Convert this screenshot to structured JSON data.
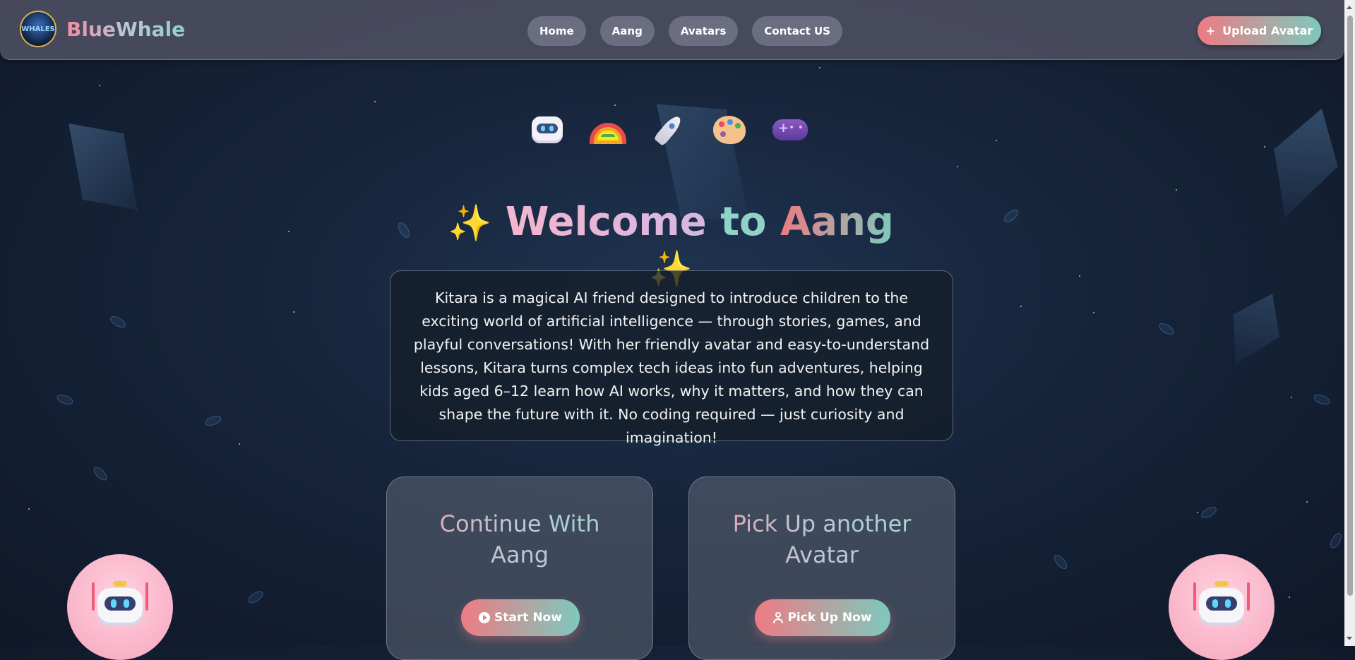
{
  "header": {
    "logo_text": "WHALES",
    "brand": "BlueWhale",
    "nav": [
      {
        "label": "Home"
      },
      {
        "label": "Aang"
      },
      {
        "label": "Avatars"
      },
      {
        "label": "Contact US"
      }
    ],
    "upload_button": {
      "icon": "+",
      "label": "Upload Avatar"
    }
  },
  "hero": {
    "emojis": [
      "robot-icon",
      "rainbow-icon",
      "rocket-icon",
      "palette-icon",
      "gamepad-icon"
    ],
    "title_prefix": "Welcome",
    "title_to": "to",
    "title_name": "Aang",
    "sparkle": "✨",
    "intro": "Kitara is a magical AI friend designed to introduce children to the exciting world of artificial intelligence — through stories, games, and playful conversations! With her friendly avatar and easy-to-understand lessons, Kitara turns complex tech ideas into fun adventures, helping kids aged 6–12 learn how AI works, why it matters, and how they can shape the future with it. No coding required — just curiosity and imagination!"
  },
  "cards": [
    {
      "title": "Continue With Aang",
      "button": "Start Now",
      "button_icon": "play-circle-icon"
    },
    {
      "title": "Pick Up another Avatar",
      "button": "Pick Up Now",
      "button_icon": "user-icon"
    }
  ],
  "colors": {
    "accent_start": "#ee7b83",
    "accent_end": "#7dc9bd",
    "background": "#16243a",
    "nav_bg": "#505064"
  }
}
